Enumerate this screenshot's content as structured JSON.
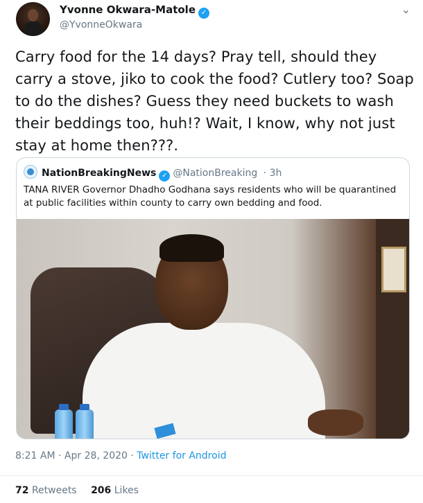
{
  "author": {
    "name": "Yvonne Okwara-Matole",
    "handle": "@YvonneOkwara",
    "verified_icon": "verified-badge-icon"
  },
  "tweet": {
    "text": "Carry food for the 14 days? Pray tell, should they carry a stove, jiko to cook the food? Cutlery too? Soap to do the dishes? Guess they need buckets to wash their beddings too, huh!? Wait, I know, why not just stay at home then???."
  },
  "quoted_tweet": {
    "name": "NationBreakingNews",
    "handle": "@NationBreaking",
    "time": "· 3h",
    "text": "TANA RIVER Governor Dhadho Godhana says residents who will be quarantined at public facilities within county to carry own bedding and food."
  },
  "meta": {
    "timestamp": "8:21 AM · Apr 28, 2020 · ",
    "source": "Twitter for Android"
  },
  "stats": {
    "retweets_count": "72",
    "retweets_label": "Retweets",
    "likes_count": "206",
    "likes_label": "Likes"
  },
  "colors": {
    "link": "#1b95e0",
    "verified": "#1da1f2",
    "secondary_text": "#657786"
  }
}
